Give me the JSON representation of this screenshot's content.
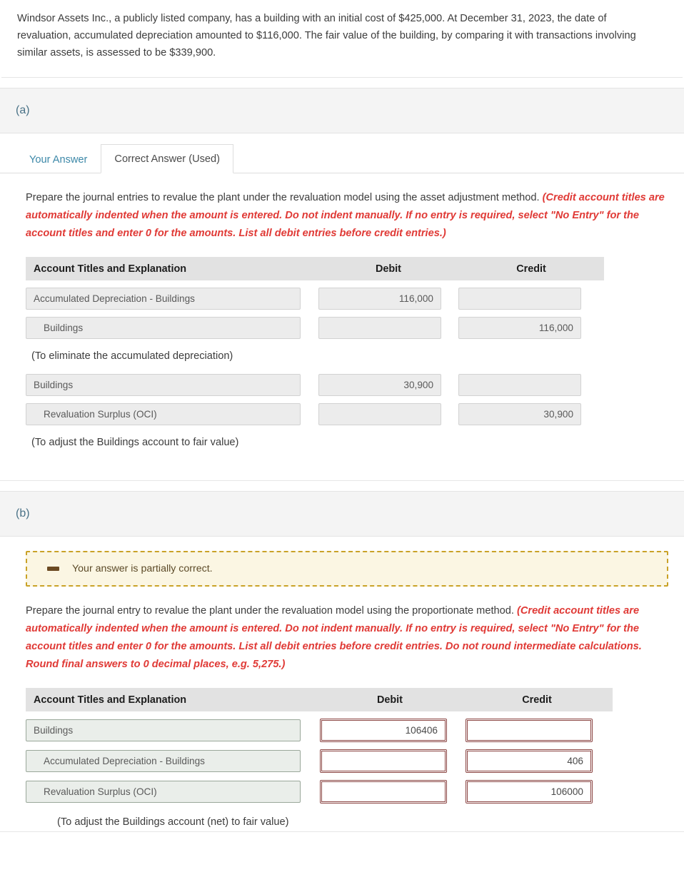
{
  "problem": {
    "text": "Windsor Assets Inc., a publicly listed company, has a building with an initial cost of $425,000. At December 31, 2023, the date of revaluation, accumulated depreciation amounted to $116,000. The fair value of the building, by comparing it with transactions involving similar assets, is assessed to be $339,900."
  },
  "part_a": {
    "label": "(a)",
    "tabs": [
      {
        "label": "Your Answer",
        "active": false
      },
      {
        "label": "Correct Answer (Used)",
        "active": true
      }
    ],
    "instruction_main": "Prepare the journal entries to revalue the plant under the revaluation model using the asset adjustment method.",
    "instruction_hint": "(Credit account titles are automatically indented when the amount is entered. Do not indent manually. If no entry is required, select \"No Entry\" for the account titles and enter 0 for the amounts. List all debit entries before credit entries.)",
    "table": {
      "columns": [
        "Account Titles and Explanation",
        "Debit",
        "Credit"
      ],
      "rows": [
        {
          "account": "Accumulated Depreciation - Buildings",
          "indent": false,
          "debit": "116,000",
          "credit": ""
        },
        {
          "account": "Buildings",
          "indent": true,
          "debit": "",
          "credit": "116,000"
        },
        {
          "caption": "(To eliminate the accumulated depreciation)"
        },
        {
          "account": "Buildings",
          "indent": false,
          "debit": "30,900",
          "credit": ""
        },
        {
          "account": "Revaluation Surplus (OCI)",
          "indent": true,
          "debit": "",
          "credit": "30,900"
        },
        {
          "caption": "(To adjust the Buildings account to fair value)"
        }
      ]
    }
  },
  "part_b": {
    "label": "(b)",
    "alert": {
      "icon": "minus-icon",
      "text": "Your answer is partially correct."
    },
    "instruction_main": "Prepare the journal entry to revalue the plant under the revaluation model using the proportionate method.",
    "instruction_hint": "(Credit account titles are automatically indented when the amount is entered. Do not indent manually. If no entry is required, select \"No Entry\" for the account titles and enter 0 for the amounts. List all debit entries before credit entries. Do not round intermediate calculations. Round final answers to 0 decimal places, e.g. 5,275.)",
    "table": {
      "columns": [
        "Account Titles and Explanation",
        "Debit",
        "Credit"
      ],
      "rows": [
        {
          "account": "Buildings",
          "indent": false,
          "debit": "106406",
          "credit": ""
        },
        {
          "account": "Accumulated Depreciation - Buildings",
          "indent": true,
          "debit": "",
          "credit": "406"
        },
        {
          "account": "Revaluation Surplus (OCI)",
          "indent": true,
          "debit": "",
          "credit": "106000"
        }
      ]
    },
    "tail_caption": "(To adjust the Buildings account (net) to fair value)"
  },
  "colors": {
    "accent_teal": "#3c88a8",
    "hint_red": "#e03a36",
    "error_border": "#8b4543",
    "alert_bg": "#fbf6e3",
    "alert_border": "#c9a227",
    "header_bg": "#e2e2e2"
  }
}
